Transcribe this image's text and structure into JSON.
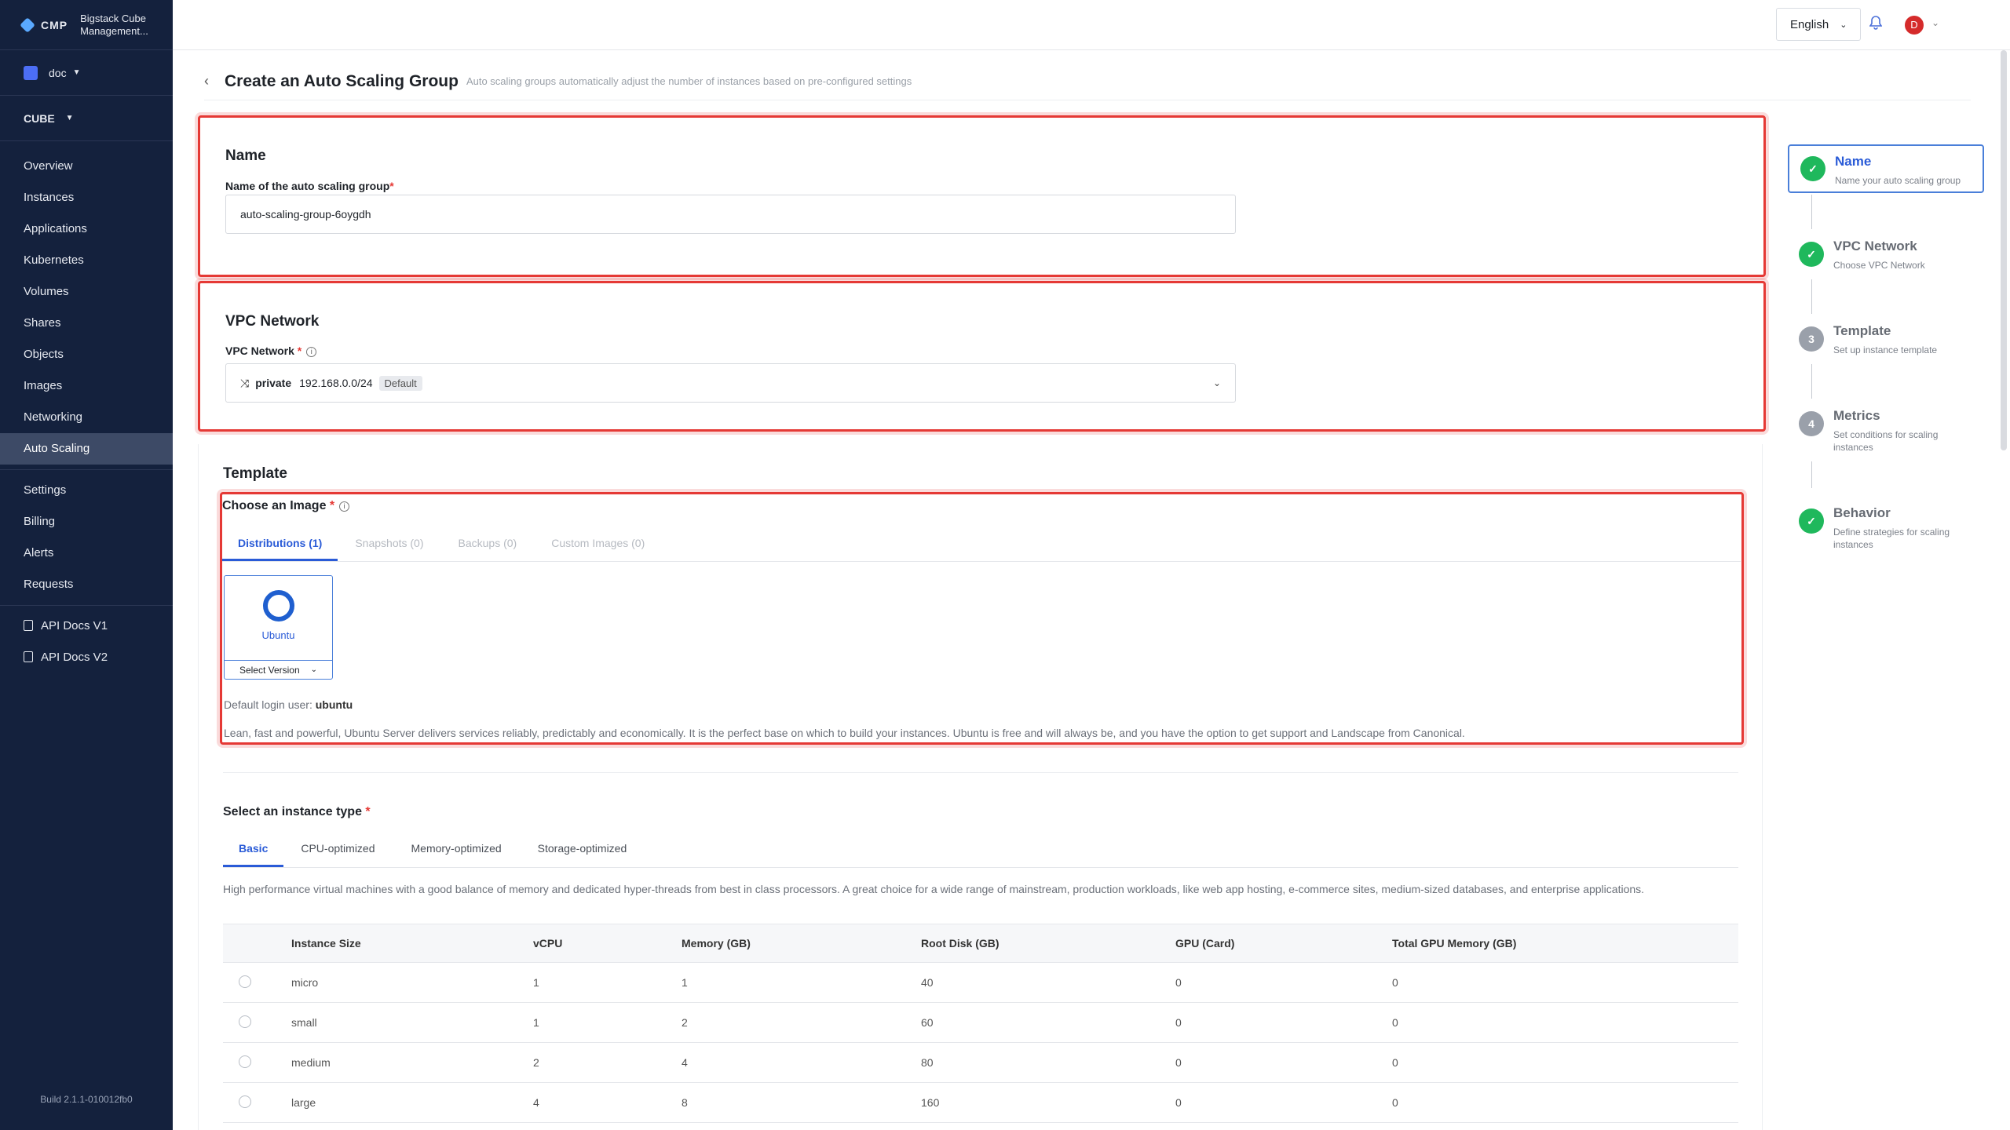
{
  "brand": {
    "logo": "CMP",
    "product": "Bigstack Cube Management..."
  },
  "project": {
    "name": "doc"
  },
  "region": {
    "name": "CUBE"
  },
  "sidebar": {
    "items": [
      "Overview",
      "Instances",
      "Applications",
      "Kubernetes",
      "Volumes",
      "Shares",
      "Objects",
      "Images",
      "Networking",
      "Auto Scaling"
    ],
    "items2": [
      "Settings",
      "Billing",
      "Alerts",
      "Requests"
    ],
    "docs": [
      "API Docs V1",
      "API Docs V2"
    ],
    "build": "Build 2.1.1-010012fb0"
  },
  "topbar": {
    "language": "English",
    "avatar_initial": "D"
  },
  "header": {
    "title": "Create an Auto Scaling Group",
    "subtitle": "Auto scaling groups automatically adjust the number of instances based on pre-configured settings"
  },
  "name_section": {
    "title": "Name",
    "label": "Name of the auto scaling group",
    "value": "auto-scaling-group-6oygdh"
  },
  "vpc_section": {
    "title": "VPC Network",
    "label": "VPC Network",
    "network": "private",
    "cidr": "192.168.0.0/24",
    "badge": "Default"
  },
  "template_section": {
    "title": "Template",
    "image_label": "Choose an Image",
    "tabs": [
      "Distributions (1)",
      "Snapshots (0)",
      "Backups (0)",
      "Custom Images (0)"
    ],
    "distro_name": "Ubuntu",
    "select_version": "Select Version",
    "login_prefix": "Default login user:",
    "login_user": "ubuntu",
    "description": "Lean, fast and powerful, Ubuntu Server delivers services reliably, predictably and economically. It is the perfect base on which to build your instances. Ubuntu is free and will always be, and you have the option to get support and Landscape from Canonical."
  },
  "instance_section": {
    "title": "Select an instance type",
    "tabs": [
      "Basic",
      "CPU-optimized",
      "Memory-optimized",
      "Storage-optimized"
    ],
    "description": "High performance virtual machines with a good balance of memory and dedicated hyper-threads from best in class processors. A great choice for a wide range of mainstream, production workloads, like web app hosting, e-commerce sites, medium-sized databases, and enterprise applications.",
    "columns": [
      "Instance Size",
      "vCPU",
      "Memory (GB)",
      "Root Disk (GB)",
      "GPU (Card)",
      "Total GPU Memory (GB)"
    ],
    "rows": [
      [
        "micro",
        "1",
        "1",
        "40",
        "0",
        "0"
      ],
      [
        "small",
        "1",
        "2",
        "60",
        "0",
        "0"
      ],
      [
        "medium",
        "2",
        "4",
        "80",
        "0",
        "0"
      ],
      [
        "large",
        "4",
        "8",
        "160",
        "0",
        "0"
      ]
    ]
  },
  "steps": [
    {
      "num": "",
      "title": "Name",
      "sub": "Name your auto scaling group",
      "state": "done"
    },
    {
      "num": "",
      "title": "VPC Network",
      "sub": "Choose VPC Network",
      "state": "done"
    },
    {
      "num": "3",
      "title": "Template",
      "sub": "Set up instance template",
      "state": "pending"
    },
    {
      "num": "4",
      "title": "Metrics",
      "sub": "Set conditions for scaling instances",
      "state": "pending"
    },
    {
      "num": "",
      "title": "Behavior",
      "sub": "Define strategies for scaling instances",
      "state": "done"
    }
  ],
  "colors": {
    "sidebar": "#14213d",
    "accent": "#2a5bd7",
    "highlight": "#e53935",
    "success": "#1fb85c"
  }
}
